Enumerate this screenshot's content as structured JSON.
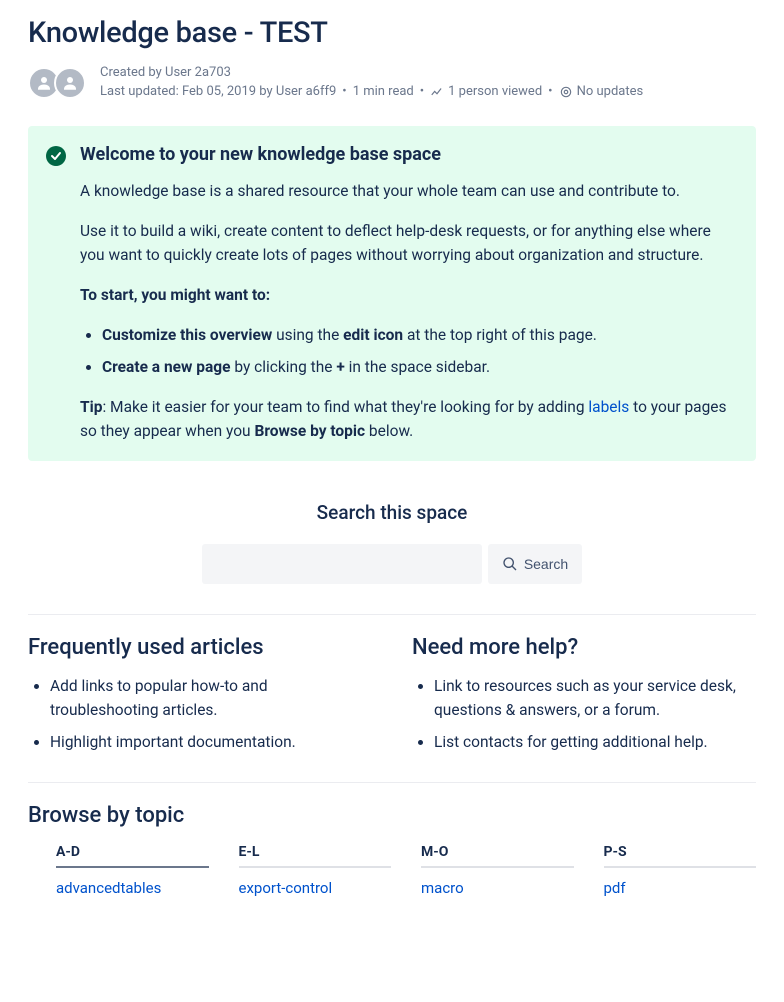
{
  "page": {
    "title": "Knowledge base - TEST"
  },
  "byline": {
    "created_by": "Created by User 2a703",
    "updated": "Last updated: Feb 05, 2019 by User a6ff9",
    "read_time": "1 min read",
    "views": "1 person viewed",
    "updates": "No updates"
  },
  "panel": {
    "title": "Welcome to your new knowledge base space",
    "p1": "A knowledge base is a shared resource that your whole team can use and contribute to.",
    "p2": "Use it to build a wiki, create content to deflect help-desk requests, or for anything else where you want to quickly create lots of pages without worrying about organization and structure.",
    "start_heading": "To start, you might want to:",
    "b1_strong": "Customize this overview",
    "b1_mid": " using the ",
    "b1_strong2": "edit icon",
    "b1_tail": " at the top right of this page.",
    "b2_strong": "Create a new page",
    "b2_mid": " by clicking the ",
    "b2_plus": "+",
    "b2_tail": " in the space sidebar.",
    "tip_label": "Tip",
    "tip_pre": ": Make it easier for your team to find what they're looking for by adding ",
    "tip_link": "labels",
    "tip_mid": " to your pages so they appear when you ",
    "tip_strong": "Browse by topic",
    "tip_tail": " below."
  },
  "search": {
    "heading": "Search this space",
    "placeholder": "",
    "button": "Search"
  },
  "columns": {
    "left": {
      "heading": "Frequently used articles",
      "items": [
        "Add links to popular how-to and troubleshooting articles.",
        "Highlight important documentation."
      ]
    },
    "right": {
      "heading": "Need more help?",
      "items": [
        "Link to resources such as your service desk, questions & answers, or a forum.",
        "List contacts for getting additional help."
      ]
    }
  },
  "browse": {
    "heading": "Browse by topic",
    "groups": [
      {
        "range": "A-D",
        "links": [
          "advancedtables"
        ]
      },
      {
        "range": "E-L",
        "links": [
          "export-control"
        ]
      },
      {
        "range": "M-O",
        "links": [
          "macro"
        ]
      },
      {
        "range": "P-S",
        "links": [
          "pdf"
        ]
      }
    ]
  }
}
